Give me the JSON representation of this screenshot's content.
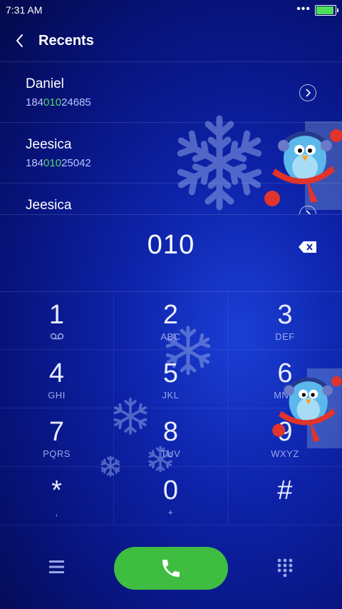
{
  "status": {
    "time": "7:31 AM",
    "dots": "•••"
  },
  "header": {
    "title": "Recents"
  },
  "recents": [
    {
      "name": "Daniel",
      "number_pre": "184",
      "number_match": "010",
      "number_post": "24685"
    },
    {
      "name": "Jeesica",
      "number_pre": "184",
      "number_match": "010",
      "number_post": "25042"
    },
    {
      "name": "Jeesica",
      "number_pre": "",
      "number_match": "",
      "number_post": ""
    }
  ],
  "dialer": {
    "input": "010"
  },
  "keys": [
    {
      "digit": "1",
      "letters": ""
    },
    {
      "digit": "2",
      "letters": "ABC"
    },
    {
      "digit": "3",
      "letters": "DEF"
    },
    {
      "digit": "4",
      "letters": "GHI"
    },
    {
      "digit": "5",
      "letters": "JKL"
    },
    {
      "digit": "6",
      "letters": "MNO"
    },
    {
      "digit": "7",
      "letters": "PQRS"
    },
    {
      "digit": "8",
      "letters": "TUV"
    },
    {
      "digit": "9",
      "letters": "WXYZ"
    },
    {
      "digit": "*",
      "letters": ","
    },
    {
      "digit": "0",
      "letters": "+"
    },
    {
      "digit": "#",
      "letters": ""
    }
  ],
  "colors": {
    "call": "#3fbd40",
    "match": "#55d66a",
    "battery": "#4ce05b"
  },
  "icons": {
    "back": "chevron-left-icon",
    "detail": "chevron-right-circle-icon",
    "backspace": "backspace-icon",
    "voicemail": "voicemail-icon",
    "menu": "menu-icon",
    "call": "phone-icon",
    "keypad": "dialpad-icon"
  }
}
